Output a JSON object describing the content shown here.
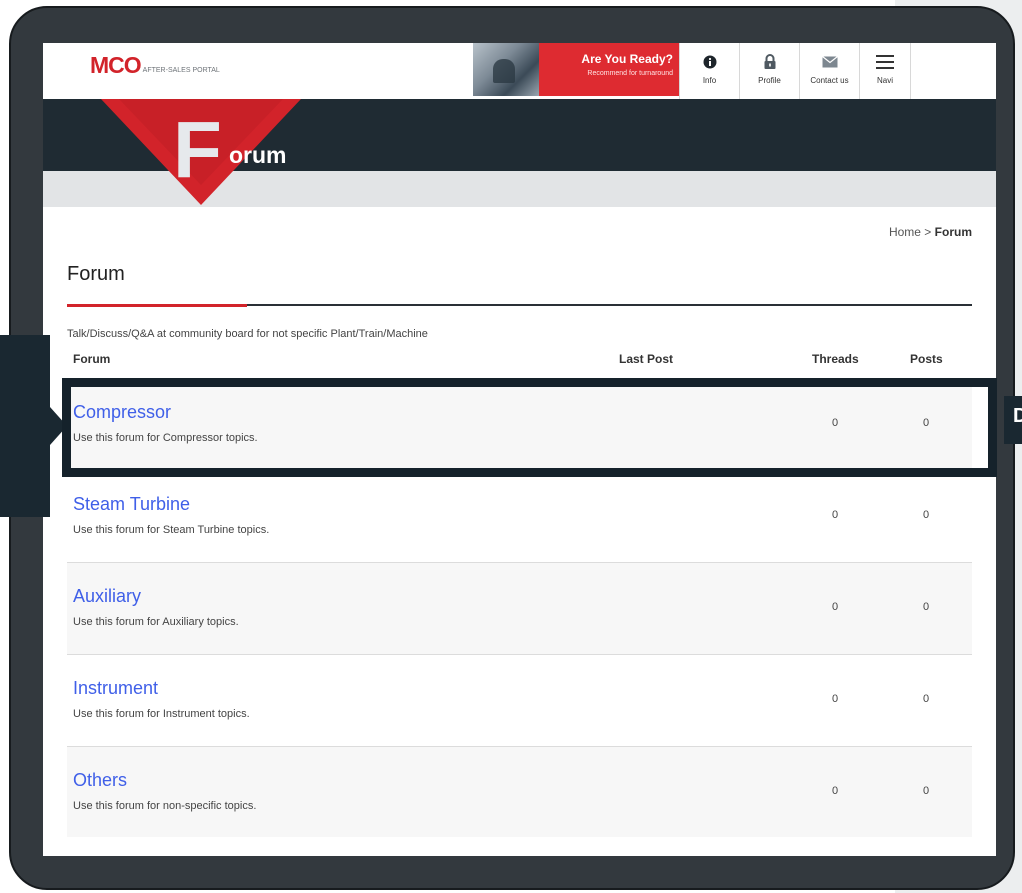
{
  "header": {
    "logo_brand": "MCO",
    "logo_tagline": "AFTER-SALES PORTAL",
    "banner_title": "Are You Ready?",
    "banner_subtitle": "Recommend for turnaround",
    "nav": [
      {
        "label": "Info",
        "icon": "info-icon"
      },
      {
        "label": "Profile",
        "icon": "lock-icon"
      },
      {
        "label": "Contact us",
        "icon": "mail-icon"
      },
      {
        "label": "Navi",
        "icon": "hamburger-menu-icon"
      }
    ],
    "hero_letter": "F",
    "hero_word": "orum"
  },
  "breadcrumb": {
    "home": "Home",
    "separator": ">",
    "current": "Forum"
  },
  "page": {
    "title": "Forum",
    "description": "Talk/Discuss/Q&A at community board for not specific Plant/Train/Machine"
  },
  "table": {
    "headers": {
      "forum": "Forum",
      "last_post": "Last Post",
      "threads": "Threads",
      "posts": "Posts"
    },
    "rows": [
      {
        "title": "Compressor",
        "subtitle": "Use this forum for Compressor topics.",
        "threads": "0",
        "posts": "0"
      },
      {
        "title": "Steam Turbine",
        "subtitle": "Use this forum for Steam Turbine topics.",
        "threads": "0",
        "posts": "0"
      },
      {
        "title": "Auxiliary",
        "subtitle": "Use this forum for Auxiliary topics.",
        "threads": "0",
        "posts": "0"
      },
      {
        "title": "Instrument",
        "subtitle": "Use this forum for Instrument topics.",
        "threads": "0",
        "posts": "0"
      },
      {
        "title": "Others",
        "subtitle": "Use this forum for non-specific topics.",
        "threads": "0",
        "posts": "0"
      }
    ]
  },
  "overlay": {
    "right_callout_letter": "D"
  },
  "colors": {
    "brand_red": "#d2232a",
    "link_blue": "#3f5fe8",
    "dark_navy": "#1f2b33",
    "frame": "#33393e"
  }
}
